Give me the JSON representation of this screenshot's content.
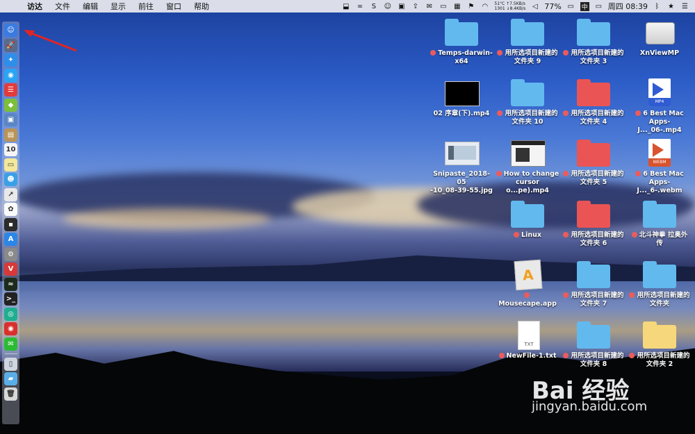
{
  "menubar": {
    "items": [
      "访达",
      "文件",
      "编辑",
      "显示",
      "前往",
      "窗口",
      "帮助"
    ],
    "status": {
      "temperature": "51°C",
      "fan_net_up": "↑7.5KB/s",
      "rpm_net_down": "1301 ↓8.4KB/s",
      "battery": "77%",
      "input_method": "中",
      "datetime": "周四 08:39"
    }
  },
  "dock": {
    "icons": [
      {
        "name": "finder-icon",
        "color": "#3a7be0",
        "glyph": "☺"
      },
      {
        "name": "launchpad-icon",
        "color": "#5a6a8a",
        "glyph": "🚀"
      },
      {
        "name": "safari-icon",
        "color": "#2e8ee8",
        "glyph": "✦"
      },
      {
        "name": "qq-browser-icon",
        "color": "#2aa4f4",
        "glyph": "◉"
      },
      {
        "name": "calendar-app-icon",
        "color": "#e23b3b",
        "glyph": "☰"
      },
      {
        "name": "android-icon",
        "color": "#7bbf3a",
        "glyph": "◆"
      },
      {
        "name": "preview-icon",
        "color": "#5b86c4",
        "glyph": "▣"
      },
      {
        "name": "notes-brown-icon",
        "color": "#b99457",
        "glyph": "▤"
      },
      {
        "name": "calendar-icon",
        "color": "#f5f5f5",
        "glyph": "10"
      },
      {
        "name": "stickies-icon",
        "color": "#f3e89b",
        "glyph": "▭"
      },
      {
        "name": "contacts-icon",
        "color": "#3aa0e6",
        "glyph": "☻"
      },
      {
        "name": "maps-icon",
        "color": "#e9e9e9",
        "glyph": "↗"
      },
      {
        "name": "photos-icon",
        "color": "#fafafa",
        "glyph": "✿"
      },
      {
        "name": "terminal-dark-icon",
        "color": "#2b2b2b",
        "glyph": "▪"
      },
      {
        "name": "app-store-icon",
        "color": "#2b86e6",
        "glyph": "A"
      },
      {
        "name": "system-preferences-icon",
        "color": "#8a8a8a",
        "glyph": "⚙"
      },
      {
        "name": "vivaldi-icon",
        "color": "#d93838",
        "glyph": "V"
      },
      {
        "name": "activity-monitor-icon",
        "color": "#1d2b1d",
        "glyph": "≈"
      },
      {
        "name": "terminal-icon",
        "color": "#222",
        "glyph": ">_"
      },
      {
        "name": "green-app-icon",
        "color": "#1fae8f",
        "glyph": "◎"
      },
      {
        "name": "netease-music-icon",
        "color": "#d9302b",
        "glyph": "◉"
      },
      {
        "name": "wechat-icon",
        "color": "#2bbb33",
        "glyph": "✉"
      },
      {
        "name": "iphone-backup-icon",
        "color": "#cfd6df",
        "glyph": "▯"
      },
      {
        "name": "downloads-folder-icon",
        "color": "#5aaee8",
        "glyph": "▰"
      },
      {
        "name": "trash-icon",
        "color": "#d8d8d8",
        "glyph": "🗑"
      }
    ]
  },
  "desktop": {
    "items": [
      {
        "name": "folder-temps-darwin",
        "kind": "folder",
        "color": "blue",
        "line1": "Temps-darwin-",
        "line2": "x64",
        "tag": true
      },
      {
        "name": "folder-new-9",
        "kind": "folder",
        "color": "blue",
        "line1": "用所选项目新建的",
        "line2": "文件夹 9",
        "tag": true
      },
      {
        "name": "folder-new-3",
        "kind": "folder",
        "color": "blue",
        "line1": "用所选项目新建的",
        "line2": "文件夹 3",
        "tag": true
      },
      {
        "name": "xnviewmp-drive",
        "kind": "drive",
        "line1": "XnViewMP",
        "line2": "",
        "tag": false
      },
      {
        "name": "video-02",
        "kind": "black",
        "line1": "02 序章(下).mp4",
        "line2": "",
        "tag": false
      },
      {
        "name": "folder-new-10",
        "kind": "folder",
        "color": "blue",
        "line1": "用所选项目新建的",
        "line2": "文件夹 10",
        "tag": true
      },
      {
        "name": "folder-new-4",
        "kind": "folder",
        "color": "red",
        "line1": "用所选项目新建的",
        "line2": "文件夹 4",
        "tag": true
      },
      {
        "name": "mp4-best-mac",
        "kind": "mp4",
        "badge": "MP4",
        "line1": "6 Best Mac",
        "line2": "Apps- J..._06-.mp4",
        "tag": true
      },
      {
        "name": "snipaste-jpg",
        "kind": "screenshot",
        "line1": "Snipaste_2018-05",
        "line2": "-10_08-39-55.jpg",
        "tag": false
      },
      {
        "name": "how-to-change-cursor",
        "kind": "browser",
        "line1": "How to change",
        "line2": "cursor o...pe).mp4",
        "tag": true
      },
      {
        "name": "folder-new-5",
        "kind": "folder",
        "color": "red",
        "line1": "用所选项目新建的",
        "line2": "文件夹 5",
        "tag": true
      },
      {
        "name": "webm-best-mac",
        "kind": "webm",
        "badge": "WEBM",
        "line1": "6 Best Mac",
        "line2": "Apps- J..._6-.webm",
        "tag": true
      },
      {
        "name": "folder-linux",
        "kind": "folder",
        "color": "blue",
        "line1": "Linux",
        "line2": "",
        "tag": true
      },
      {
        "name": "folder-new-6",
        "kind": "folder",
        "color": "red",
        "line1": "用所选项目新建的",
        "line2": "文件夹 6",
        "tag": true
      },
      {
        "name": "folder-beidou",
        "kind": "folder",
        "color": "blue",
        "line1": "北斗神拳 拉奥外",
        "line2": "传",
        "tag": true
      },
      {
        "name": "mousecape-app",
        "kind": "app",
        "line1": "Mousecape.app",
        "line2": "",
        "tag": true
      },
      {
        "name": "folder-new-7",
        "kind": "folder",
        "color": "blue",
        "line1": "用所选项目新建的",
        "line2": "文件夹 7",
        "tag": true
      },
      {
        "name": "folder-new-plain",
        "kind": "folder",
        "color": "blue",
        "line1": "用所选项目新建的",
        "line2": "文件夹",
        "tag": true
      },
      {
        "name": "newfile-txt",
        "kind": "txt",
        "badge": "TXT",
        "line1": "NewFile-1.txt",
        "line2": "",
        "tag": true
      },
      {
        "name": "folder-new-8",
        "kind": "folder",
        "color": "blue",
        "line1": "用所选项目新建的",
        "line2": "文件夹 8",
        "tag": true
      },
      {
        "name": "folder-new-2",
        "kind": "folder",
        "color": "yellow",
        "line1": "用所选项目新建的",
        "line2": "文件夹 2",
        "tag": true
      }
    ]
  },
  "watermark": {
    "text": "Bai 经验",
    "sub": "jingyan.baidu.com"
  }
}
